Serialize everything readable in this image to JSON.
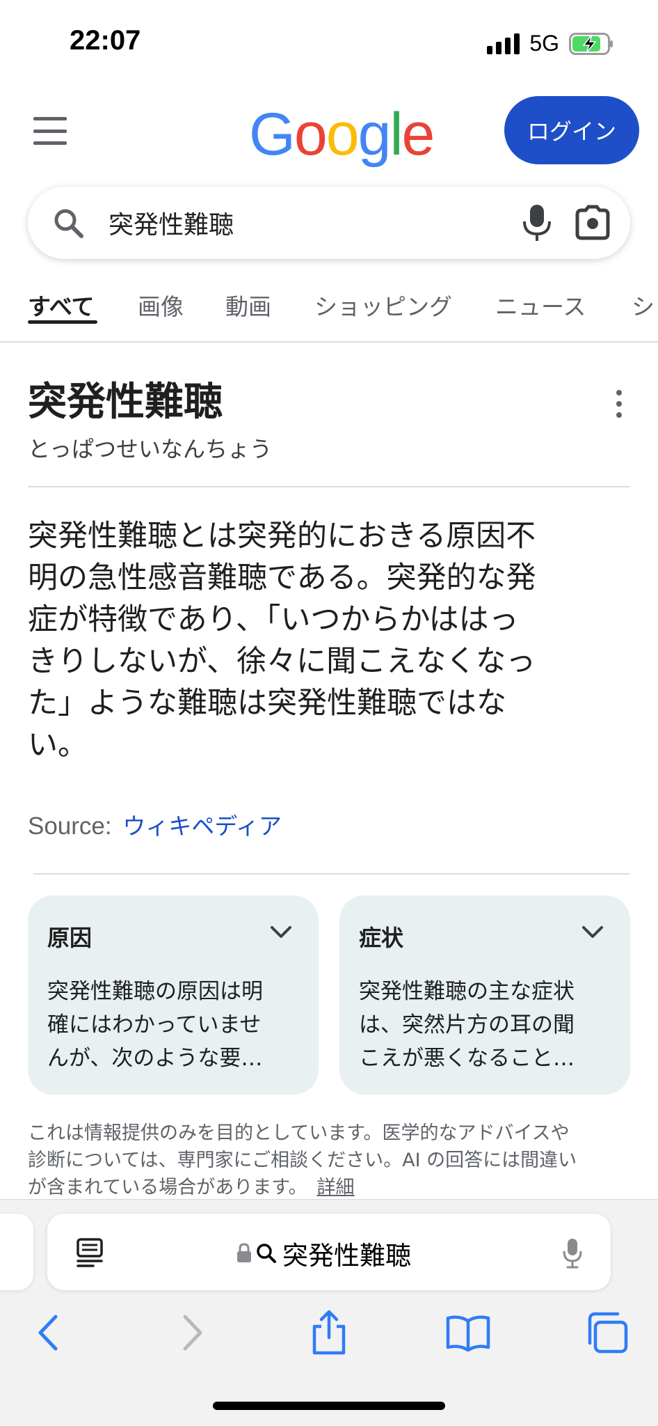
{
  "status_bar": {
    "time": "22:07",
    "network": "5G",
    "battery_charging": true
  },
  "header": {
    "menu_icon": "hamburger-menu-icon",
    "logo_letters": [
      "G",
      "o",
      "o",
      "g",
      "l",
      "e"
    ],
    "login_label": "ログイン"
  },
  "search": {
    "query": "突発性難聴",
    "icons": [
      "search-icon",
      "microphone-icon",
      "google-lens-icon"
    ]
  },
  "tabs": [
    {
      "label": "すべて",
      "active": true
    },
    {
      "label": "画像",
      "active": false
    },
    {
      "label": "動画",
      "active": false
    },
    {
      "label": "ショッピング",
      "active": false
    },
    {
      "label": "ニュース",
      "active": false
    },
    {
      "label": "シ",
      "active": false
    }
  ],
  "knowledge_panel": {
    "title": "突発性難聴",
    "reading": "とっぱつせいなんちょう",
    "description_lines": [
      "突発性難聴とは突発的におきる原因不",
      "明の急性感音難聴である。突発的な発",
      "症が特徴であり、「いつからかははっ",
      "きりしないが、徐々に聞こえなくなっ",
      "た」ような難聴は突発性難聴ではな",
      "い。"
    ],
    "source_label": "Source:",
    "source_link": "ウィキペディア"
  },
  "cards": [
    {
      "title": "原因",
      "text_lines": [
        "突発性難聴の原因は明",
        "確にはわかっていませ",
        "んが、次のような要…"
      ]
    },
    {
      "title": "症状",
      "text_lines": [
        "突発性難聴の主な症状",
        "は、突然片方の耳の聞",
        "こえが悪くなること…"
      ]
    }
  ],
  "disclaimer": {
    "lines": [
      "これは情報提供のみを目的としています。医学的なアドバイスや",
      "診断については、専門家にご相談ください。AI の回答には間違い",
      "が含まれている場合があります。"
    ],
    "link": "詳細"
  },
  "safari": {
    "address_text": "突発性難聴",
    "toolbar_icons": [
      "back-icon",
      "forward-icon",
      "share-icon",
      "bookmarks-icon",
      "tabs-icon"
    ]
  },
  "colors": {
    "brand_blue": "#1e4fc8",
    "link_blue": "#1a4fc8",
    "card_bg": "#e8f0f2",
    "safari_blue": "#2f7cf6"
  }
}
